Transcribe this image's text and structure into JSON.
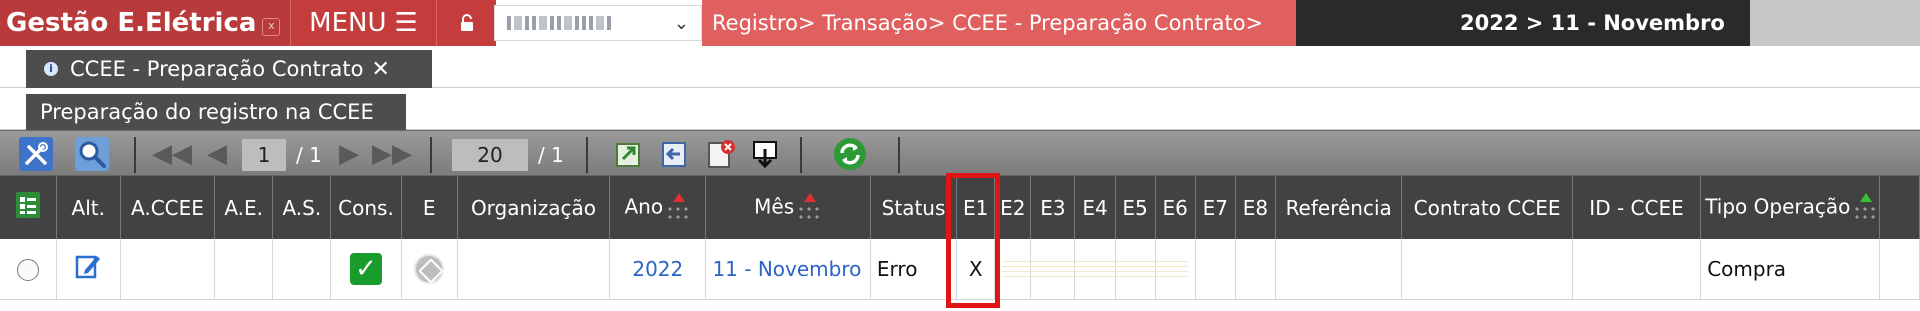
{
  "app": {
    "title": "Gestão E.Elétrica",
    "close_mark": "x",
    "menu_label": "MENU",
    "menu_icon": "hamburger-icon",
    "lock_icon": "lock-icon",
    "company_select_chevron": "⌄"
  },
  "breadcrumb": "Registro> Transação> CCEE - Preparação Contrato>",
  "period": "2022 > 11 - Novembro",
  "tab": {
    "label": "CCEE - Preparação Contrato",
    "close": "✕"
  },
  "section": {
    "title": "Preparação do registro na CCEE"
  },
  "toolbar": {
    "tools_icon": "tools-icon",
    "search_icon": "search-icon",
    "page_current": "1",
    "page_total": "/ 1",
    "page_size": "20",
    "page_size_total": "/ 1",
    "export_icons": [
      "export-icon",
      "import-icon",
      "print-delete-icon",
      "download-icon"
    ],
    "refresh_icon": "refresh-icon"
  },
  "grid": {
    "columns": [
      "Alt.",
      "A.CCEE",
      "A.E.",
      "A.S.",
      "Cons.",
      "E",
      "Organização",
      "Ano",
      "Mês",
      "Status",
      "E1",
      "E2",
      "E3",
      "E4",
      "E5",
      "E6",
      "E7",
      "E8",
      "Referência",
      "Contrato CCEE",
      "ID - CCEE",
      "Tipo Operação"
    ],
    "rows": [
      {
        "ano": "2022",
        "mes": "11 - Novembro",
        "status": "Erro",
        "e1": "X",
        "tipo_operacao": "Compra"
      }
    ]
  },
  "colors": {
    "brand": "#b93a3a",
    "breadcrumb": "#e06060",
    "period_bg": "#2a2a2a",
    "header_bg": "#424242",
    "highlight": "#e01414",
    "link": "#2b63c6"
  }
}
